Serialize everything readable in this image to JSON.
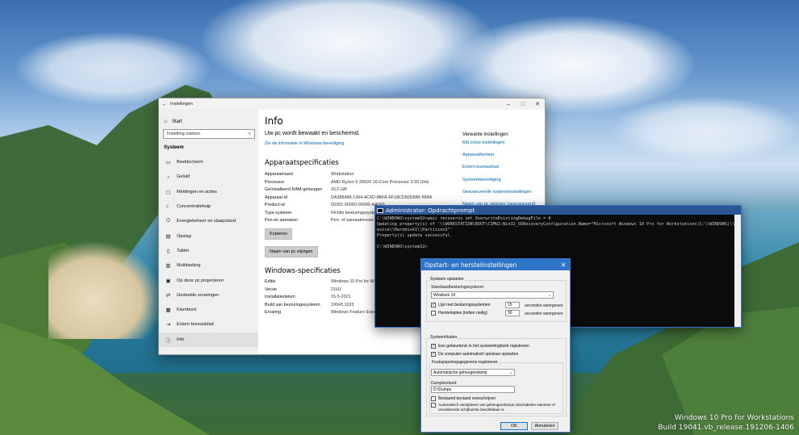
{
  "desktop": {
    "watermark_line1": "Windows 10 Pro for Workstations",
    "watermark_line2": "Build 19041.vb_release.191206-1406"
  },
  "settings": {
    "window_title": "Instellingen",
    "back_icon": "back-arrow-icon",
    "start_label": "Start",
    "search_placeholder": "Instelling zoeken",
    "section_label": "Systeem",
    "nav_items": [
      {
        "label": "Beeldscherm",
        "icon": "display-icon"
      },
      {
        "label": "Geluid",
        "icon": "speaker-icon"
      },
      {
        "label": "Meldingen en acties",
        "icon": "notifications-icon"
      },
      {
        "label": "Concentratiehulp",
        "icon": "moon-icon"
      },
      {
        "label": "Energiebeheer en slaapstand",
        "icon": "power-icon"
      },
      {
        "label": "Opslag",
        "icon": "storage-icon"
      },
      {
        "label": "Tablet",
        "icon": "tablet-icon"
      },
      {
        "label": "Multitasking",
        "icon": "multitasking-icon"
      },
      {
        "label": "Op deze pc projecteren",
        "icon": "project-icon"
      },
      {
        "label": "Gedeelde ervaringen",
        "icon": "shared-experiences-icon"
      },
      {
        "label": "Klembord",
        "icon": "clipboard-icon"
      },
      {
        "label": "Extern bureaublad",
        "icon": "remote-desktop-icon"
      },
      {
        "label": "Info",
        "icon": "info-icon"
      }
    ],
    "page_title": "Info",
    "protection_text": "Uw pc wordt bewaakt en beschermd.",
    "security_link": "Zie de informatie in Windows-beveiliging",
    "device_specs_title": "Apparaatspecificaties",
    "device_specs": [
      {
        "key": "Apparaatnaam",
        "value": "Workstation"
      },
      {
        "key": "Processor",
        "value": "AMD Ryzen 9 3950X 16-Core Processor        3.50 GHz"
      },
      {
        "key": "Geïnstalleerd RAM-geheugen",
        "value": "16,0 GB"
      },
      {
        "key": "Apparaat-id",
        "value": "DA388488-1364-4C6D-8BFA-6F18CD80D8A5 889A"
      },
      {
        "key": "Product-id",
        "value": "00391-90050-00000-AA000"
      },
      {
        "key": "Type systeem",
        "value": "64-bits besturingssysteem, x64-processor"
      },
      {
        "key": "Pen en aanraken",
        "value": "Pen- of aanraakinvoer is niet beschikbaar voor dit beeldscherm"
      }
    ],
    "copy_button": "Kopieren",
    "rename_button": "Naam van pc wijzigen",
    "windows_specs_title": "Windows-specificaties",
    "windows_specs": [
      {
        "key": "Editie",
        "value": "Windows 10 Pro for Workstations"
      },
      {
        "key": "Versie",
        "value": "21H1"
      },
      {
        "key": "Installatiedatum",
        "value": "15-5-2021"
      },
      {
        "key": "Build van besturingssysteem",
        "value": "19043.1023"
      },
      {
        "key": "Ervaring",
        "value": "Windows Feature Experience Pack 120.2212.2020.0"
      }
    ],
    "related_title": "Verwante instellingen",
    "related_links": [
      "BitLocker-instellingen",
      "Apparaatbeheer",
      "Extern bureaublad",
      "Systeembeveiliging",
      "Geavanceerde systeeminstellingen",
      "Naam van pc wijzigen (geavanceerd)"
    ]
  },
  "cmd": {
    "title": "Administrator: Opdrachtprompt",
    "lines": [
      "C:\\WINDOWS\\system32>wmic recoveros set OverwriteExistingDebugFile = 0",
      "Updating property(s) of '\\\\WORKSTATION\\ROOT\\CIMV2:Win32_OSRecoveryConfiguration.Name=\"Microsoft Windows 10 Pro for Workstations|C:\\\\WINDOWS|\\\\D",
      "evice\\\\Harddisk1\\\\Partition3\"'",
      "Property(s) update successful.",
      "",
      "C:\\WINDOWS\\system32>"
    ]
  },
  "dialog": {
    "title": "Opstart- en herstelinstellingen",
    "close_icon": "close-icon",
    "startup_group": "Systeem opstarten",
    "default_os_label": "Standaardbesturingssysteem:",
    "default_os_value": "Windows 10",
    "os_list_label": "Lijst met besturingssystemen",
    "os_list_checked": true,
    "os_list_seconds": "15",
    "recovery_options_label": "Herstelopties (indien nodig)",
    "recovery_options_checked": false,
    "recovery_options_seconds": "30",
    "seconds_label": "seconden weergeven",
    "failure_group": "Systeemfouten",
    "log_event_label": "Een gebeurtenis in het systeemlogboek registreren",
    "log_event_checked": true,
    "auto_restart_label": "De computer automatisch opnieuw opstarten",
    "auto_restart_checked": true,
    "debug_info_label": "Foutopsporingsgegevens registreren",
    "dump_type_value": "Automatische geheugendump",
    "dump_file_label": "Dumpbestand:",
    "dump_file_value": "D:\\Dumps",
    "overwrite_label": "Bestaand bestand overschrijven",
    "overwrite_checked": false,
    "auto_delete_label": "Automatisch verwijderen van geheugendumps uitschakelen wanneer er onvoldoende schijfruimte beschikbaar is",
    "auto_delete_checked": false,
    "ok_button": "OK",
    "cancel_button": "Annuleren"
  }
}
